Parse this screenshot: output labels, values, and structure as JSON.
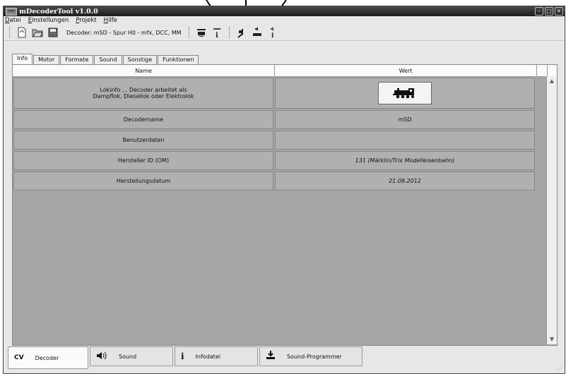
{
  "window": {
    "title": "mDecoderTool v1.0.0"
  },
  "menu": [
    "Datei",
    "Einstellungen",
    "Projekt",
    "Hilfe"
  ],
  "toolbar": {
    "decoder_label": "Decoder: mSD - Spur H0 - mfx, DCC, MM"
  },
  "tabs": [
    "Info",
    "Motor",
    "Formate",
    "Sound",
    "Sonstige",
    "Funktionen"
  ],
  "table": {
    "headers": [
      "Name",
      "Wert"
    ],
    "rows": [
      {
        "name_line1": "Lokinfo ... Decoder arbeitet als",
        "name_line2": "Dampflok, Diesellok oder Elektrolok",
        "value": ""
      },
      {
        "name": "Decodername",
        "value": "mSD"
      },
      {
        "name": "Benutzerdaten",
        "value": ""
      },
      {
        "name": "Hersteller ID (OM)",
        "value": "131 (Märklin/Trix Modelleisenbahn)"
      },
      {
        "name": "Herstellungsdatum",
        "value": "21.09.2012"
      }
    ]
  },
  "bottom_tabs": [
    {
      "label": "Decoder",
      "icon": "cv-loco-icon",
      "icon_text": "CV"
    },
    {
      "label": "Sound",
      "icon": "speaker-icon"
    },
    {
      "label": "Infodatei",
      "icon": "info-icon",
      "icon_text": "i"
    },
    {
      "label": "Sound-Programmer",
      "icon": "download-loco-icon"
    }
  ]
}
